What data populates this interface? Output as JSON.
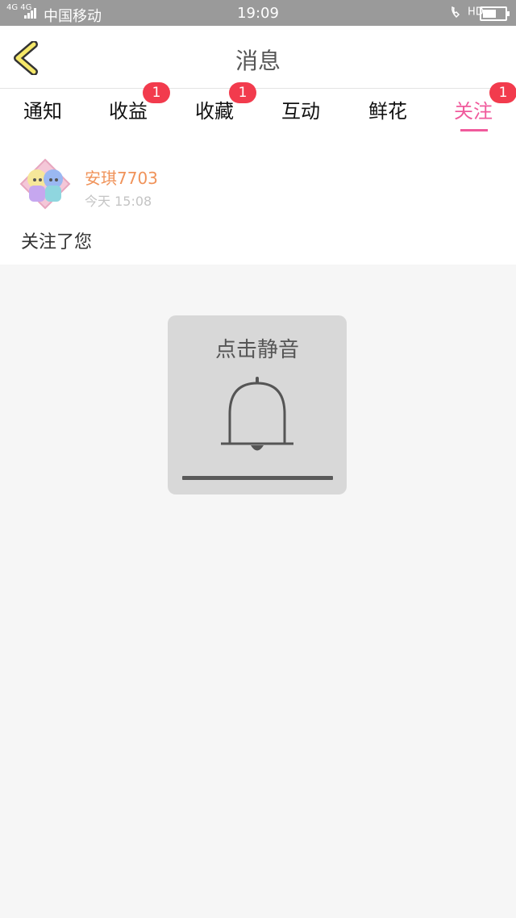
{
  "status_bar": {
    "network": "4G 4G",
    "carrier": "中国移动",
    "time": "19:09",
    "hd_label": "HD"
  },
  "header": {
    "title": "消息",
    "back_icon": "chevron-left-icon",
    "back_color": "#f5e86a"
  },
  "tabs": [
    {
      "label": "通知",
      "badge": ""
    },
    {
      "label": "收益",
      "badge": "1"
    },
    {
      "label": "收藏",
      "badge": "1"
    },
    {
      "label": "互动",
      "badge": ""
    },
    {
      "label": "鲜花",
      "badge": ""
    },
    {
      "label": "关注",
      "badge": "1",
      "active": true
    }
  ],
  "message": {
    "username": "安琪7703",
    "time": "今天 15:08",
    "text": "关注了您"
  },
  "mute_overlay": {
    "label": "点击静音",
    "icon": "bell-icon"
  },
  "colors": {
    "accent": "#f05a9c",
    "badge": "#f23b4d",
    "username": "#f0935a"
  }
}
